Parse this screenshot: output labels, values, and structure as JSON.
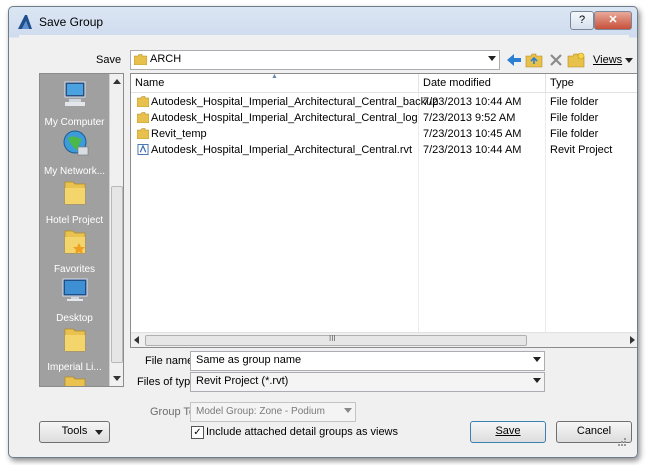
{
  "window": {
    "title": "Save Group",
    "help_label": "?",
    "close_label": "✕"
  },
  "save_in": {
    "label": "Save",
    "current": "ARCH"
  },
  "toolbar": {
    "views_label": "Views"
  },
  "places": [
    {
      "name": "My Computer",
      "icon": "computer-icon"
    },
    {
      "name": "My Network...",
      "icon": "network-icon"
    },
    {
      "name": "Hotel Project",
      "icon": "folder-icon"
    },
    {
      "name": "Favorites",
      "icon": "favorites-folder-icon"
    },
    {
      "name": "Desktop",
      "icon": "desktop-icon"
    },
    {
      "name": "Imperial Li...",
      "icon": "folder-icon"
    }
  ],
  "columns": {
    "name": "Name",
    "date": "Date modified",
    "type": "Type"
  },
  "files": [
    {
      "name": "Autodesk_Hospital_Imperial_Architectural_Central_backup",
      "date": "7/23/2013 10:44 AM",
      "type": "File folder",
      "icon": "folder-icon"
    },
    {
      "name": "Autodesk_Hospital_Imperial_Architectural_Central_log",
      "date": "7/23/2013 9:52 AM",
      "type": "File folder",
      "icon": "folder-icon"
    },
    {
      "name": "Revit_temp",
      "date": "7/23/2013 10:45 AM",
      "type": "File folder",
      "icon": "folder-icon"
    },
    {
      "name": "Autodesk_Hospital_Imperial_Architectural_Central.rvt",
      "date": "7/23/2013 10:44 AM",
      "type": "Revit Project",
      "icon": "revit-file-icon"
    }
  ],
  "hscroll_grip": "III",
  "file_name": {
    "label": "File name:",
    "value": "Same as group name"
  },
  "file_type": {
    "label": "Files of type:",
    "value": "Revit Project  (*.rvt)"
  },
  "group_to": {
    "label": "Group To",
    "value": "Model Group: Zone - Podium"
  },
  "include_detail": {
    "label": "Include attached detail groups as views",
    "checked": true
  },
  "buttons": {
    "tools": "Tools",
    "save": "Save",
    "cancel": "Cancel"
  },
  "colors": {
    "places_bg": "#a0a0a0",
    "accent": "#3c7fb1",
    "folder": "#e8c04c"
  }
}
